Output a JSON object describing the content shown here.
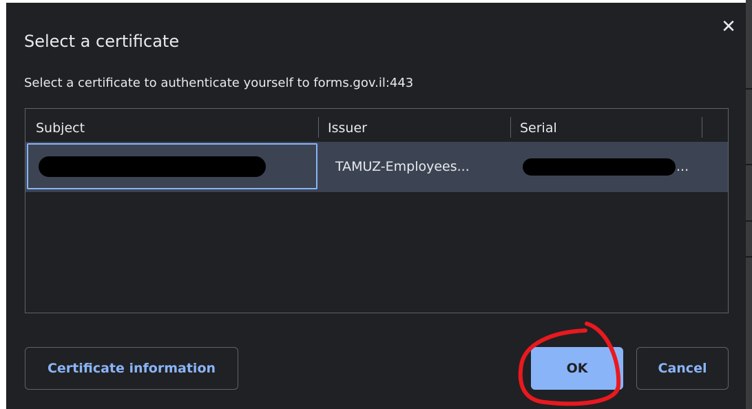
{
  "dialog": {
    "title": "Select a certificate",
    "subtitle": "Select a certificate to authenticate yourself to forms.gov.il:443",
    "close_icon": "close-icon",
    "close_glyph": "✕"
  },
  "table": {
    "columns": [
      "Subject",
      "Issuer",
      "Serial"
    ],
    "rows": [
      {
        "subject": "",
        "issuer": "TAMUZ-Employees...",
        "serial": "..."
      }
    ]
  },
  "buttons": {
    "certificate_information": "Certificate information",
    "ok": "OK",
    "cancel": "Cancel"
  },
  "colors": {
    "background": "#202124",
    "text": "#e8eaed",
    "accent": "#8ab4f8",
    "selected_row": "#3c4453",
    "border": "#5f6368",
    "annotation": "#e8191f"
  }
}
